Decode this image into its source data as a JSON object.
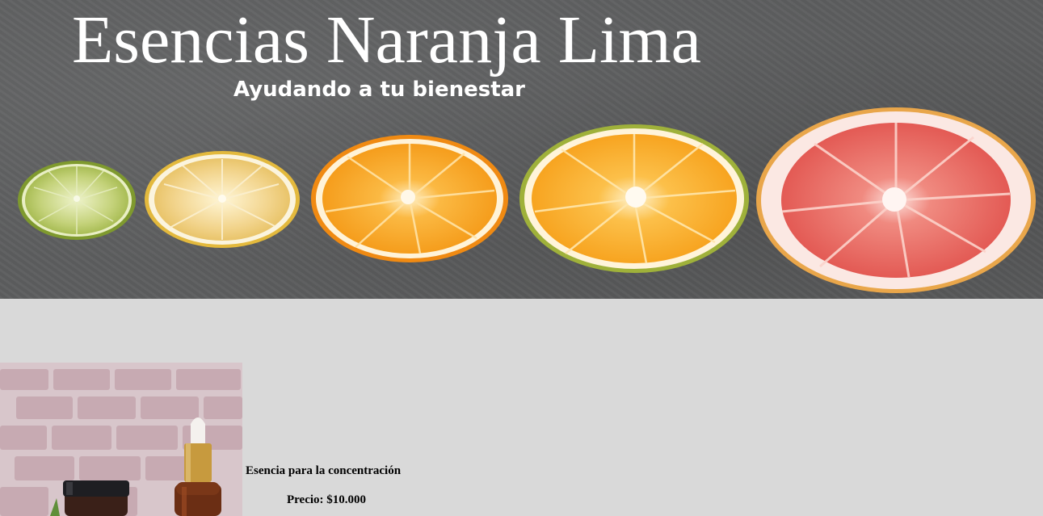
{
  "header": {
    "title": "Esencias Naranja Lima",
    "subtitle": "Ayudando a tu bienestar",
    "banner_image": "citrus-slices-on-slate",
    "citrus_slices": [
      "lime",
      "lemon",
      "orange",
      "orange",
      "grapefruit"
    ]
  },
  "products": [
    {
      "name": "Esencia para la concentración",
      "price_label": "Precio: $10.000",
      "image": "essential-oil-bottles"
    }
  ],
  "colors": {
    "page_background": "#d9d9d9",
    "banner_background": "#5d5e5f",
    "title_text": "#ffffff",
    "product_text": "#000000"
  }
}
